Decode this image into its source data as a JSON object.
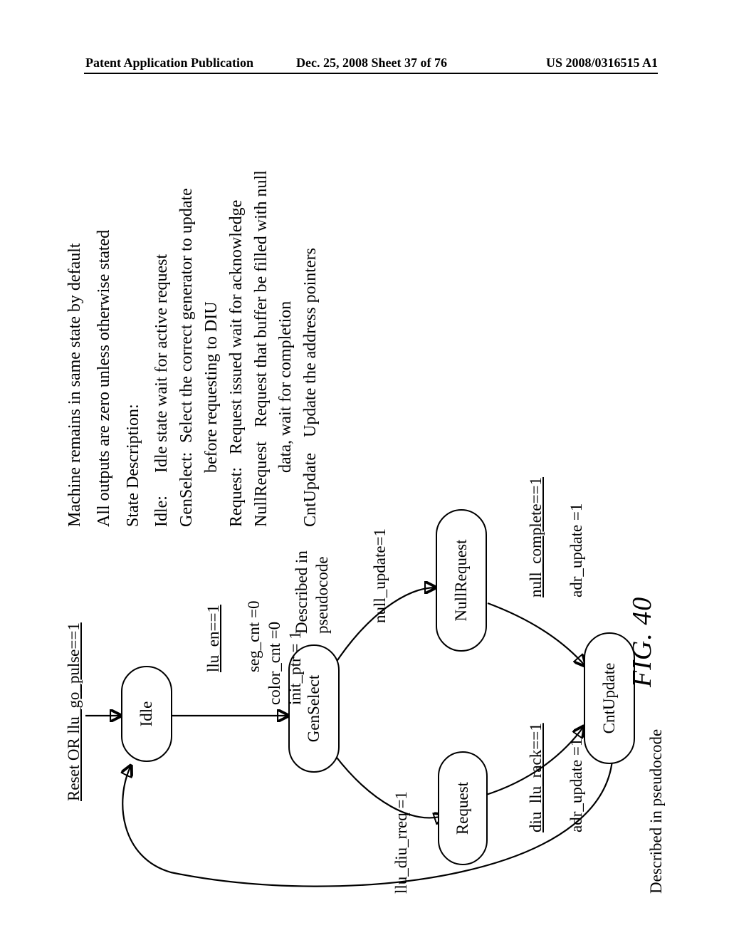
{
  "header": {
    "left": "Patent Application Publication",
    "center": "Dec. 25, 2008  Sheet 37 of 76",
    "right": "US 2008/0316515 A1"
  },
  "caption": "FIG. 40",
  "states": {
    "idle": "Idle",
    "genselect": "GenSelect",
    "request": "Request",
    "nullrequest": "NullRequest",
    "cntupdate": "CntUpdate"
  },
  "edges": {
    "reset": "Reset OR llu_go_pulse==1",
    "llu_en": "llu_en==1",
    "llu_en_acts": "seg_cnt =0\ncolor_cnt =0\ninit_ptr = 1",
    "gensel_note": "Described in\npseudocode",
    "diu_req": "llu_diu_rreq =1",
    "diu_rack": "diu_llu_rack==1",
    "diu_rack_act": "adr_update =1",
    "null_update": "null_update=1",
    "null_complete": "null_complete==1",
    "null_complete_act": "adr_update =1",
    "cnt_note": "Described in pseudocode"
  },
  "desc_head1": "Machine remains in same state by default",
  "desc_head2": "All outputs are zero unless otherwise stated",
  "desc_title": "State Description:",
  "desc": {
    "idle_k": "Idle:",
    "idle_v": "Idle state wait for active request",
    "gensel_k": "GenSelect:",
    "gensel_v1": "Select the correct generator to update",
    "gensel_v2": "before requesting to DIU",
    "req_k": "Request:",
    "req_v": "Request issued wait for acknowledge",
    "nreq_k": "NullRequest",
    "nreq_v1": "Request that buffer be filled with null",
    "nreq_v2": "data, wait for completion",
    "cnt_k": "CntUpdate",
    "cnt_v": "Update the address pointers"
  }
}
